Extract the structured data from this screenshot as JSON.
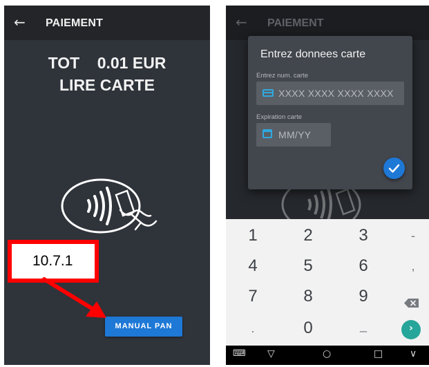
{
  "left_screen": {
    "back_glyph": "←",
    "title": "PAIEMENT",
    "total_text": "TOT    0.01 EUR",
    "read_text": "LIRE CARTE",
    "manual_pan_label": "MANUAL PAN",
    "accent_color": "#1e78d6"
  },
  "annotation": {
    "label": "10.7.1",
    "color": "#ff0000"
  },
  "right_screen": {
    "back_glyph": "←",
    "title": "PAIEMENT",
    "dialog": {
      "title": "Entrez donnees carte",
      "card_label": "Entrez num. carte",
      "card_placeholder": "XXXX XXXX XXXX XXXX",
      "expiry_label": "Expiration carte",
      "expiry_placeholder": "MM/YY",
      "card_icon": "credit-card-icon",
      "expiry_icon": "calendar-icon",
      "confirm_icon": "checkmark-icon"
    },
    "keypad": {
      "row1": [
        "1",
        "2",
        "3",
        "-"
      ],
      "row2": [
        "4",
        "5",
        "6",
        ","
      ],
      "row3": [
        "7",
        "8",
        "9"
      ],
      "row4": [
        ".",
        "0",
        "_"
      ],
      "backspace_icon": "backspace-icon",
      "go_glyph": "›",
      "go_color": "#26a69a"
    },
    "navbar": {
      "keyboard_glyph": "⌨",
      "back_glyph": "▽",
      "home_glyph": "○",
      "recents_glyph": "□",
      "hide_glyph": "∨"
    }
  }
}
